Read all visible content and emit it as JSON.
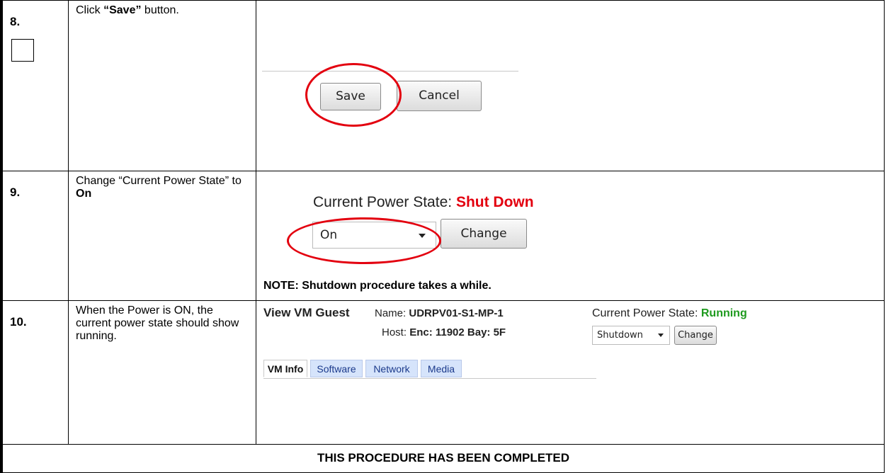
{
  "steps": [
    {
      "number": "8.",
      "instruction": {
        "pre": "Click ",
        "bold": "“Save”",
        "post": " button."
      },
      "screenshot": {
        "save_label": "Save",
        "cancel_label": "Cancel"
      }
    },
    {
      "number": "9.",
      "instruction": {
        "pre": "Change “Current Power State” to ",
        "bold": "On"
      },
      "screenshot": {
        "power_state_label": "Current Power State:",
        "power_state_value": "Shut Down",
        "power_state_value_color": "#e3000f",
        "select_value": "On",
        "change_label": "Change",
        "note": "NOTE: Shutdown procedure takes a while."
      }
    },
    {
      "number": "10.",
      "instruction": {
        "text": "When the Power is ON, the current power state should show running."
      },
      "screenshot": {
        "title": "View VM Guest",
        "name_label": "Name:",
        "name_value": "UDRPV01-S1-MP-1",
        "host_label": "Host:",
        "host_value": "Enc: 11902 Bay: 5F",
        "power_state_label": "Current Power State:",
        "power_state_value": "Running",
        "power_state_value_color": "#1e9a1e",
        "select_value": "Shutdown",
        "change_label": "Change",
        "tabs": [
          "VM Info",
          "Software",
          "Network",
          "Media"
        ]
      }
    }
  ],
  "footer": "THIS PROCEDURE HAS BEEN COMPLETED",
  "highlight_color": "#e3000f"
}
